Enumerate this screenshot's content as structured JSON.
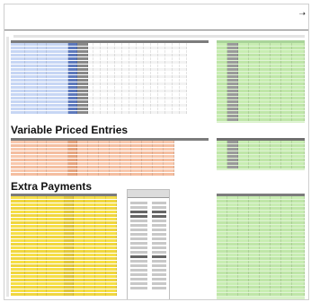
{
  "sections": {
    "variable_title": "Variable Priced Entries",
    "extra_title": "Extra Payments"
  },
  "colors": {
    "blue": "#c7d6f4",
    "blue_dark": "#5d79bd",
    "orange": "#f8c8ad",
    "orange_dark": "#e7a57f",
    "yellow": "#f6df47",
    "green": "#c8edb2",
    "gray_col": "#8a8a8a",
    "border": "#cfcfcf"
  },
  "icons": {
    "corner_arrow": "arrow-icon"
  }
}
